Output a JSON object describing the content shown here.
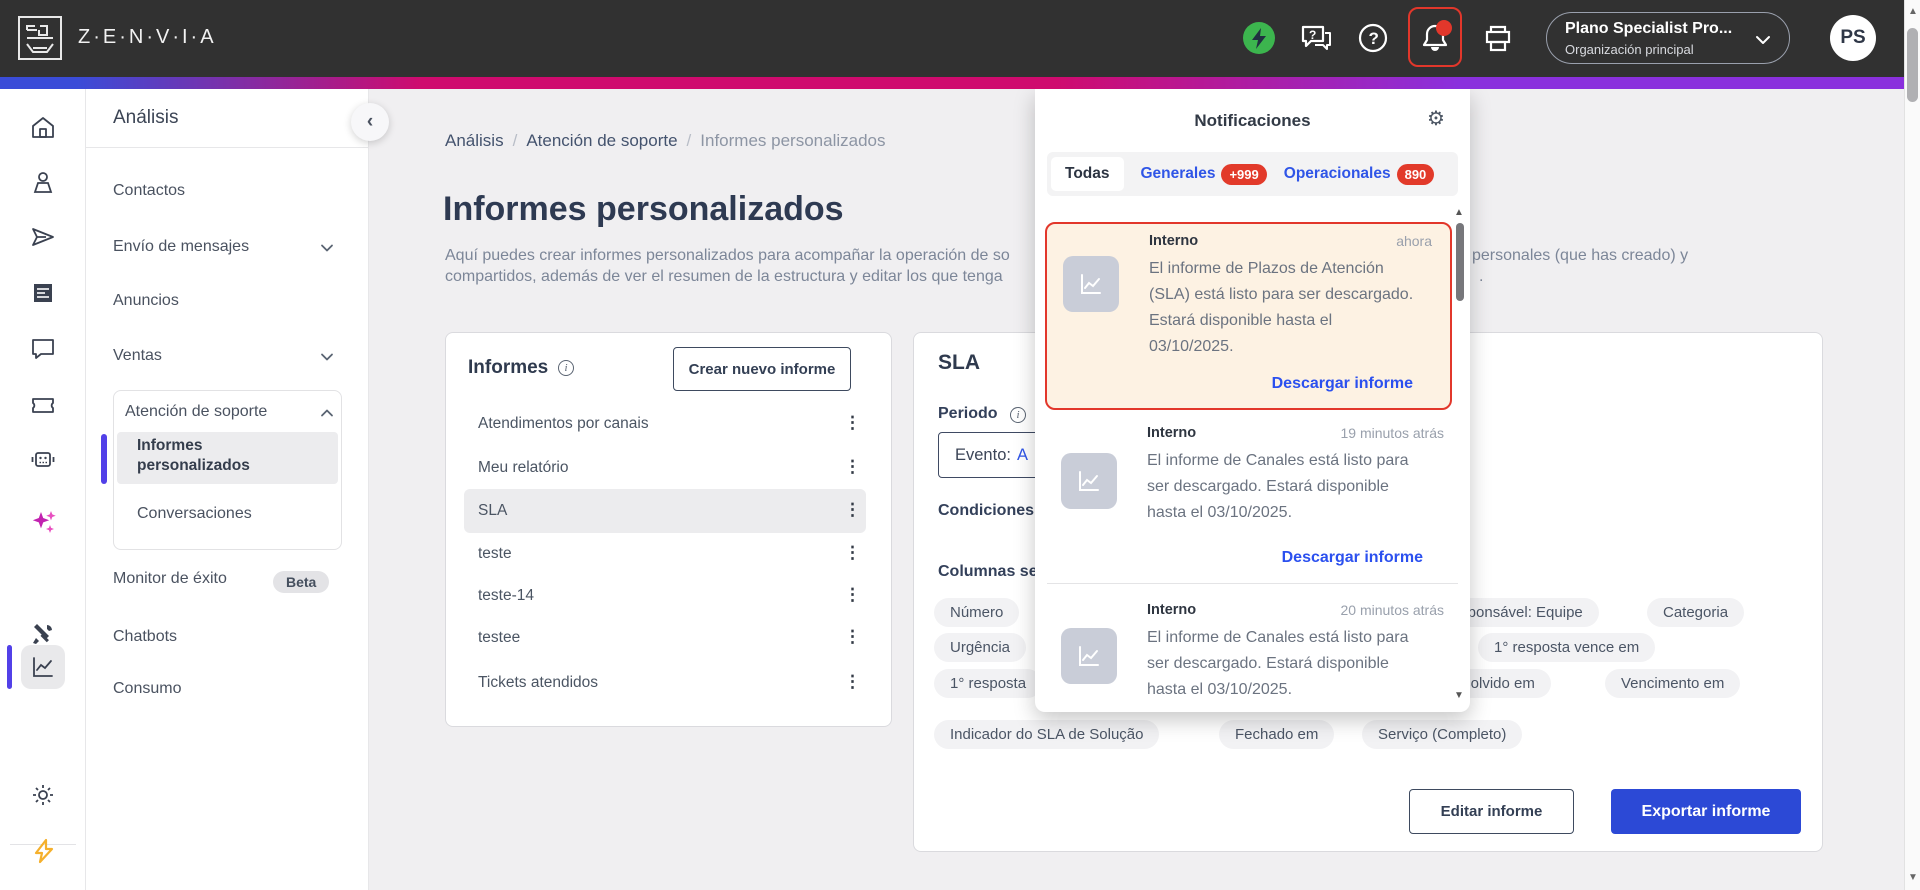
{
  "header": {
    "logo_text": "Z·E·N·V·I·A",
    "plan_name": "Plano Specialist Pro...",
    "plan_org": "Organización principal",
    "avatar_initials": "PS"
  },
  "nav": {
    "section_title": "Análisis",
    "items": [
      {
        "label": "Contactos"
      },
      {
        "label": "Envío de mensajes"
      },
      {
        "label": "Anuncios"
      },
      {
        "label": "Ventas"
      }
    ],
    "support_group": {
      "label": "Atención de soporte",
      "children": [
        {
          "label": "Informes personalizados"
        },
        {
          "label": "Conversaciones"
        }
      ]
    },
    "monitor_label": "Monitor de éxito",
    "monitor_badge": "Beta",
    "chatbots_label": "Chatbots",
    "consumo_label": "Consumo"
  },
  "breadcrumb": {
    "items": [
      "Análisis",
      "Atención de soporte",
      "Informes personalizados"
    ],
    "separator": "/"
  },
  "page": {
    "title": "Informes personalizados",
    "desc_line1_left": "Aquí puedes crear informes personalizados para acompañar la operación de so",
    "desc_line1_right": "personales (que has creado) y",
    "desc_line2_left": "compartidos, además de ver el resumen de la estructura y editar los que tenga",
    "desc_line2_right": "."
  },
  "reports": {
    "title": "Informes",
    "create_button": "Crear nuevo informe",
    "items": [
      {
        "label": "Atendimentos por canais"
      },
      {
        "label": "Meu relatório"
      },
      {
        "label": "SLA"
      },
      {
        "label": "teste"
      },
      {
        "label": "teste-14"
      },
      {
        "label": "testee"
      },
      {
        "label": "Tickets atendidos"
      }
    ]
  },
  "sla": {
    "title": "SLA",
    "periodo_label": "Periodo",
    "evento_prefix": "Evento:",
    "evento_value": "A",
    "condiciones_label": "Condiciones",
    "columnas_label": "Columnas seleccionadas",
    "chips_left": [
      "Número",
      "Urgência",
      "1° resposta"
    ],
    "chips_right_row1": [
      "Responsável: Equipe",
      "Categoria"
    ],
    "chips_right_row2": [
      "1° resposta vence em"
    ],
    "chips_right_row3": [
      "Resolvido em",
      "Vencimento em"
    ],
    "chips_bottom": [
      "Indicador do SLA de Solução",
      "Fechado em",
      "Serviço (Completo)"
    ],
    "editar_button": "Editar informe",
    "exportar_button": "Exportar informe"
  },
  "notifications": {
    "title": "Notificaciones",
    "tabs": [
      {
        "label": "Todas",
        "badge": ""
      },
      {
        "label": "Generales",
        "badge": "+999"
      },
      {
        "label": "Operacionales",
        "badge": "890"
      }
    ],
    "items": [
      {
        "source": "Interno",
        "time": "ahora",
        "body": "El informe de Plazos de Atención (SLA) está listo para ser descargado. Estará disponible hasta el 03/10/2025.",
        "link": "Descargar informe"
      },
      {
        "source": "Interno",
        "time": "19 minutos atrás",
        "body": "El informe de Canales está listo para ser descargado. Estará disponible hasta el 03/10/2025.",
        "link": "Descargar informe"
      },
      {
        "source": "Interno",
        "time": "20 minutos atrás",
        "body": "El informe de Canales está listo para ser descargado. Estará disponible hasta el 03/10/2025.",
        "link": ""
      }
    ]
  },
  "icons": {
    "kebab": "⋮",
    "gear": "⚙",
    "info": "i",
    "chevron_left": "‹",
    "up_arrow": "▲",
    "down_arrow": "▼"
  },
  "colors": {
    "header_bg": "#313131",
    "accent_blue": "#2f55e7",
    "button_blue": "#2c49d6",
    "alert_red": "#e2372b",
    "magenta": "#cf0b6e",
    "purple": "#8a30dd",
    "indigo_indicator": "#5240e8",
    "green_status": "#3cb54e",
    "notification_peach": "#fdf2e3"
  }
}
